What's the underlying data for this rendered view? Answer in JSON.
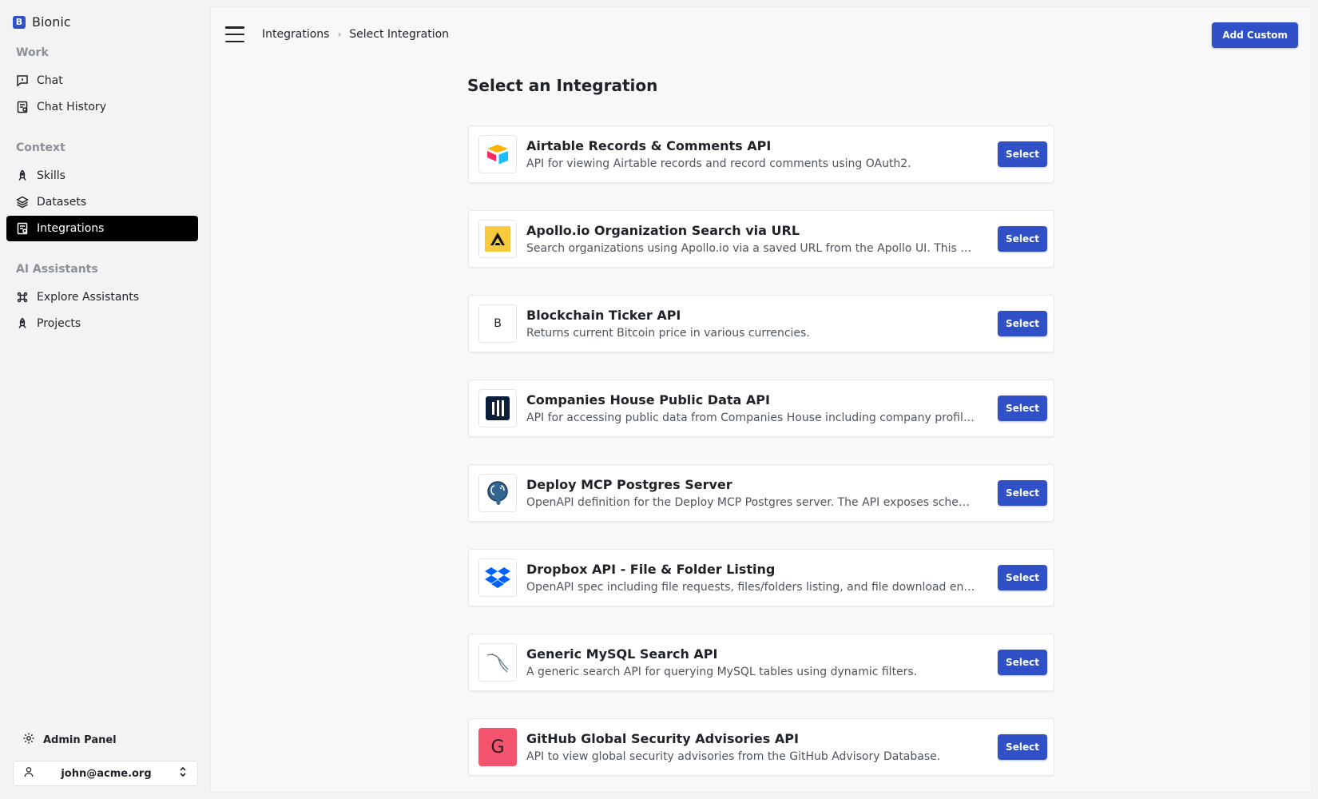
{
  "app": {
    "name": "Bionic",
    "logo_letter": "B",
    "accent": "#3050c8"
  },
  "sidebar": {
    "sections": [
      {
        "title": "Work",
        "items": [
          {
            "label": "Chat",
            "icon": "chat-icon"
          },
          {
            "label": "Chat History",
            "icon": "history-icon"
          }
        ]
      },
      {
        "title": "Context",
        "items": [
          {
            "label": "Skills",
            "icon": "rocket-icon"
          },
          {
            "label": "Datasets",
            "icon": "layers-icon"
          },
          {
            "label": "Integrations",
            "icon": "document-icon",
            "active": true
          }
        ]
      },
      {
        "title": "AI Assistants",
        "items": [
          {
            "label": "Explore Assistants",
            "icon": "command-icon"
          },
          {
            "label": "Projects",
            "icon": "rocket-icon"
          }
        ]
      }
    ],
    "admin_label": "Admin Panel",
    "user_email": "john@acme.org"
  },
  "header": {
    "breadcrumb": [
      "Integrations",
      "Select Integration"
    ],
    "add_custom_label": "Add Custom"
  },
  "page": {
    "title": "Select an Integration",
    "select_label": "Select",
    "integrations": [
      {
        "title": "Airtable Records & Comments API",
        "description": "API for viewing Airtable records and record comments using OAuth2.",
        "logo": "airtable-logo"
      },
      {
        "title": "Apollo.io Organization Search via URL",
        "description": "Search organizations using Apollo.io via a saved URL from the Apollo UI. This endpoint returns organization results.",
        "logo": "apollo-logo"
      },
      {
        "title": "Blockchain Ticker API",
        "description": "Returns current Bitcoin price in various currencies.",
        "logo": "letter-b-logo",
        "logo_letter": "B"
      },
      {
        "title": "Companies House Public Data API",
        "description": "API for accessing public data from Companies House including company profiles, officers and filings.",
        "logo": "companies-house-logo"
      },
      {
        "title": "Deploy MCP Postgres Server",
        "description": "OpenAPI definition for the Deploy MCP Postgres server. The API exposes schema discovery and query tools.",
        "logo": "postgres-logo"
      },
      {
        "title": "Dropbox API - File & Folder Listing",
        "description": "OpenAPI spec including file requests, files/folders listing, and file download endpoints for Dropbox.",
        "logo": "dropbox-logo"
      },
      {
        "title": "Generic MySQL Search API",
        "description": "A generic search API for querying MySQL tables using dynamic filters.",
        "logo": "mysql-logo"
      },
      {
        "title": "GitHub Global Security Advisories API",
        "description": "API to view global security advisories from the GitHub Advisory Database.",
        "logo": "letter-g-logo",
        "logo_letter": "G"
      }
    ]
  }
}
